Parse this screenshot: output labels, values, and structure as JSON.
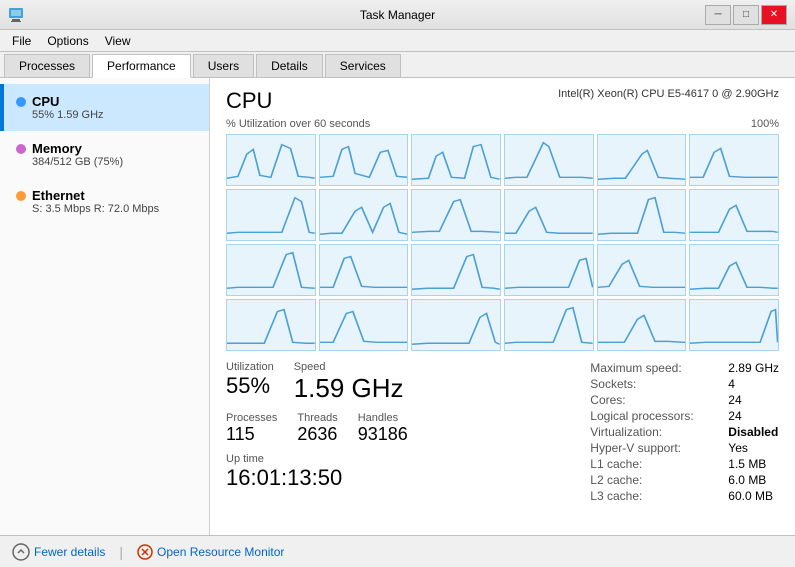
{
  "titleBar": {
    "title": "Task Manager",
    "minimizeBtn": "─",
    "maximizeBtn": "□",
    "closeBtn": "✕"
  },
  "menuBar": {
    "items": [
      "File",
      "Options",
      "View"
    ]
  },
  "tabs": {
    "items": [
      "Processes",
      "Performance",
      "Users",
      "Details",
      "Services"
    ],
    "activeIndex": 1
  },
  "sidebar": {
    "items": [
      {
        "name": "CPU",
        "detail": "55%  1.59 GHz",
        "dotColor": "#3399ff",
        "active": true
      },
      {
        "name": "Memory",
        "detail": "384/512 GB (75%)",
        "dotColor": "#cc66cc",
        "active": false
      },
      {
        "name": "Ethernet",
        "detail": "S: 3.5 Mbps  R: 72.0 Mbps",
        "dotColor": "#ff9933",
        "active": false
      }
    ]
  },
  "detail": {
    "title": "CPU",
    "subtitle": "Intel(R) Xeon(R) CPU E5-4617 0 @ 2.90GHz",
    "graphLabel": "% Utilization over 60 seconds",
    "graphMaxLabel": "100%",
    "stats": {
      "utilization": {
        "label": "Utilization",
        "value": "55%"
      },
      "speed": {
        "label": "Speed",
        "value": "1.59 GHz"
      },
      "processes": {
        "label": "Processes",
        "value": "115"
      },
      "threads": {
        "label": "Threads",
        "value": "2636"
      },
      "handles": {
        "label": "Handles",
        "value": "93186"
      },
      "uptime": {
        "label": "Up time",
        "value": "16:01:13:50"
      }
    },
    "rightStats": [
      {
        "label": "Maximum speed:",
        "value": "2.89 GHz"
      },
      {
        "label": "Sockets:",
        "value": "4"
      },
      {
        "label": "Cores:",
        "value": "24"
      },
      {
        "label": "Logical processors:",
        "value": "24"
      },
      {
        "label": "Virtualization:",
        "value": "Disabled",
        "bold": true
      },
      {
        "label": "Hyper-V support:",
        "value": "Yes"
      },
      {
        "label": "L1 cache:",
        "value": "1.5 MB"
      },
      {
        "label": "L2 cache:",
        "value": "6.0 MB"
      },
      {
        "label": "L3 cache:",
        "value": "60.0 MB"
      }
    ]
  },
  "footer": {
    "fewerDetails": "Fewer details",
    "openResourceMonitor": "Open Resource Monitor"
  }
}
